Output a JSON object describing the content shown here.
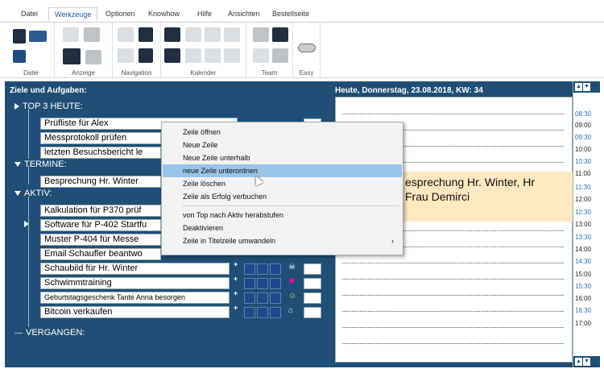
{
  "tabs": [
    {
      "label": "Datei",
      "active": false
    },
    {
      "label": "Werkzeuge",
      "active": true
    },
    {
      "label": "Optionen",
      "active": false
    },
    {
      "label": "Knowhow",
      "active": false
    },
    {
      "label": "Hilfe",
      "active": false
    },
    {
      "label": "Ansichten",
      "active": false
    },
    {
      "label": "Bestellseite",
      "active": false
    }
  ],
  "ribbon_groups": [
    "Datei",
    "Anzeige",
    "Navigation",
    "Kalender",
    "Team",
    "Easy"
  ],
  "left_panel": {
    "title": "Ziele und Aufgaben:",
    "sections": {
      "top3": "TOP 3 HEUTE:",
      "termine": "TERMINE:",
      "aktiv": "AKTIV:",
      "vergangen": "VERGANGEN:"
    },
    "rows": [
      "Prüfliste für Alex",
      "Messprotokoll prüfen",
      "letzten Besuchsbericht le",
      "Besprechung Hr. Winter",
      "Kalkulation für P370 prüf",
      "Software für P-402 Startfu",
      "Muster P-404 für Messe",
      "Email Schaufler beantwo",
      "Schaubild für Hr. Winter",
      "Schwimmtraining",
      "Geburtstagsgeschenk Tante Anna besorgen",
      "Bitcoin verkaufen"
    ]
  },
  "day_panel": {
    "header": "Heute, Donnerstag, 23.08.2018, KW: 34",
    "appointment_line1": "esprechung Hr. Winter, Hr",
    "appointment_line2": "Frau Demirci"
  },
  "timeline": [
    "08:30",
    "09:00",
    "09:30",
    "10:00",
    "10:30",
    "11:00",
    "11:30",
    "12:00",
    "12:30",
    "13:00",
    "13:30",
    "14:00",
    "14:30",
    "15:00",
    "15:30",
    "16:00",
    "16:30",
    "17:00"
  ],
  "context_menu": {
    "items": [
      "Zeile öffnen",
      "Neue Zeile",
      "Neue Zeile unterhalb",
      "neue Zeile unterordnen",
      "Zeile löschen",
      "Zeile als Erfolg verbuchen",
      "von Top nach Aktiv herabstufen",
      "Deaktivieren",
      "Zeile in Titelzeile umwandeln"
    ],
    "highlighted_index": 3,
    "submenu_arrow": "›"
  },
  "colors": {
    "panel_bg": "#1f4f76",
    "menu_highlight": "#9ac5ea",
    "appointment_bg": "#fde8c0",
    "time_blue": "#2a6db5"
  }
}
